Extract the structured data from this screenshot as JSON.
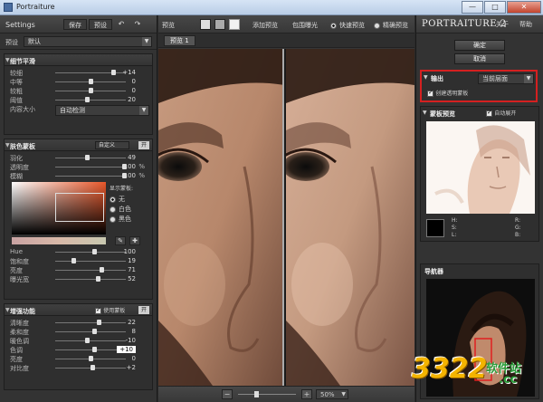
{
  "window": {
    "title": "Portraiture",
    "minimize": "—",
    "maximize": "□",
    "close": "✕"
  },
  "left": {
    "settings": "Settings",
    "save": "保存",
    "presets": "预设",
    "undo_icon": "↶",
    "redo_icon": "↷",
    "preset_label": "预设",
    "preset_value": "默认",
    "detail": {
      "title": "细节平滑",
      "sliders": [
        {
          "label": "较细",
          "value": "+14",
          "pos": 0.82
        },
        {
          "label": "中等",
          "value": "0",
          "pos": 0.5
        },
        {
          "label": "较粗",
          "value": "0",
          "pos": 0.5
        },
        {
          "label": "阈值",
          "value": "20",
          "pos": 0.45
        }
      ],
      "size_label": "内容大小",
      "size_value": "自动检测"
    },
    "mask": {
      "title": "肤色蒙板",
      "mode": "自定义",
      "on": "开",
      "sliders": [
        {
          "label": "羽化",
          "value": "49",
          "unit": "",
          "pos": 0.45
        },
        {
          "label": "透明度",
          "value": "100",
          "unit": "%",
          "pos": 0.98
        },
        {
          "label": "模糊",
          "value": "100",
          "unit": "%",
          "pos": 0.98
        }
      ],
      "show_mask": "显示蒙板:",
      "opt_none": "无",
      "opt_white": "白色",
      "opt_black": "黑色",
      "hue_sliders": [
        {
          "label": "Hue",
          "value": "100",
          "pos": 0.55
        },
        {
          "label": "饱和度",
          "value": "19",
          "pos": 0.25
        },
        {
          "label": "亮度",
          "value": "71",
          "pos": 0.65
        },
        {
          "label": "曝光宽",
          "value": "52",
          "pos": 0.6
        }
      ]
    },
    "enhance": {
      "title": "增强功能",
      "use_mask": "使用蒙板",
      "on": "开",
      "sliders": [
        {
          "label": "清晰度",
          "value": "22",
          "pos": 0.62
        },
        {
          "label": "柔和度",
          "value": "8",
          "pos": 0.55
        },
        {
          "label": "暖色调",
          "value": "-10",
          "pos": 0.45
        },
        {
          "label": "色调",
          "value": "+10",
          "pos": 0.55
        },
        {
          "label": "亮度",
          "value": "0",
          "pos": 0.5
        },
        {
          "label": "对比度",
          "value": "+2",
          "pos": 0.52
        }
      ]
    }
  },
  "center": {
    "preview": "预览",
    "add_preview": "添加预览",
    "before_after": "包围曝光",
    "quick_preview": "快速预览",
    "accurate_preview": "精确预览",
    "tab": "预览 1",
    "zoom": "50%",
    "zoom_minus": "−",
    "zoom_plus": "+"
  },
  "right": {
    "logo": "PORTRAITURE 2",
    "about": "关于",
    "help": "帮助",
    "ok": "确定",
    "cancel": "取消",
    "output": {
      "title": "输出",
      "target": "当前层面",
      "create_mask": "创建透明蒙板"
    },
    "mask_preview": {
      "title": "蒙板预览",
      "auto": "自动展开",
      "h": "H:",
      "s": "S:",
      "l": "L:",
      "r": "R:",
      "g": "G:",
      "b": "B:"
    },
    "navigator": {
      "title": "导航器"
    }
  },
  "watermark": {
    "text": "3322",
    "brand": "软件站",
    "url": ".cc"
  }
}
